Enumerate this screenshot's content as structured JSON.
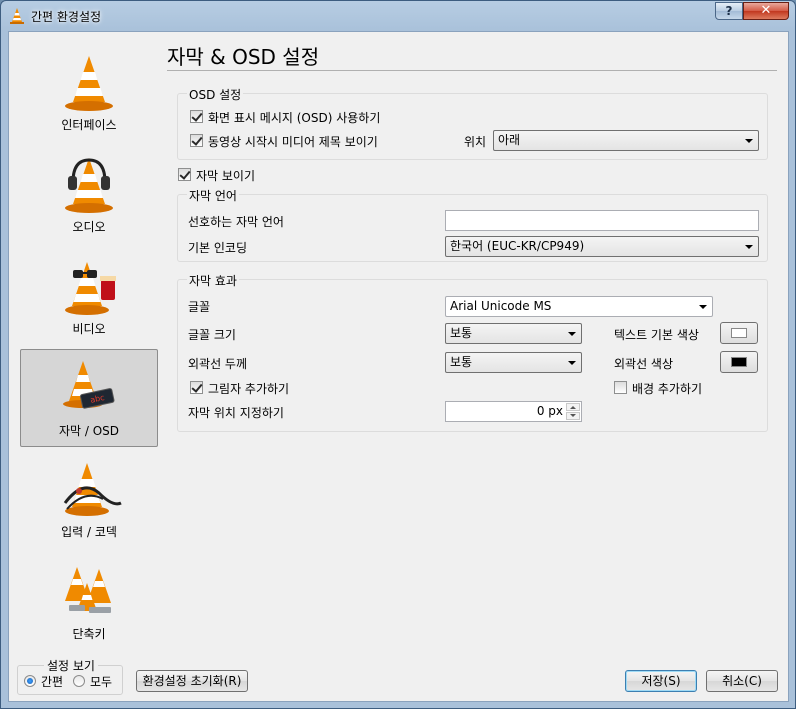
{
  "window": {
    "title": "간편 환경설정",
    "help_label": "?",
    "close_label": "✕"
  },
  "sidebar": {
    "items": [
      {
        "label": "인터페이스"
      },
      {
        "label": "오디오"
      },
      {
        "label": "비디오"
      },
      {
        "label": "자막 / OSD"
      },
      {
        "label": "입력 / 코덱"
      },
      {
        "label": "단축키"
      }
    ],
    "selected_index": 3
  },
  "view": {
    "group_title": "설정 보기",
    "simple_label": "간편",
    "all_label": "모두"
  },
  "main": {
    "title": "자막 & OSD 설정",
    "osd": {
      "group_title": "OSD 설정",
      "show_osd_label": "화면 표시 메시지 (OSD) 사용하기",
      "show_title_label": "동영상 시작시 미디어 제목 보이기",
      "position_label": "위치",
      "position_value": "아래"
    },
    "show_subtitles_label": "자막 보이기",
    "language": {
      "group_title": "자막 언어",
      "preferred_label": "선호하는 자막 언어",
      "preferred_value": "",
      "encoding_label": "기본 인코딩",
      "encoding_value": "한국어 (EUC-KR/CP949)"
    },
    "effects": {
      "group_title": "자막 효과",
      "font_label": "글꼴",
      "font_value": "Arial Unicode MS",
      "size_label": "글꼴 크기",
      "size_value": "보통",
      "text_color_label": "텍스트 기본 색상",
      "outline_label": "외곽선 두께",
      "outline_value": "보통",
      "outline_color_label": "외곽선 색상",
      "shadow_label": "그림자 추가하기",
      "background_label": "배경 추가하기",
      "position_label": "자막 위치 지정하기",
      "position_value": "0 px"
    }
  },
  "footer": {
    "reset_label": "환경설정 초기화(R)",
    "save_label": "저장(S)",
    "cancel_label": "취소(C)"
  },
  "colors": {
    "text_color": "#ffffff",
    "outline_color": "#000000",
    "accent": "#f07f00"
  }
}
